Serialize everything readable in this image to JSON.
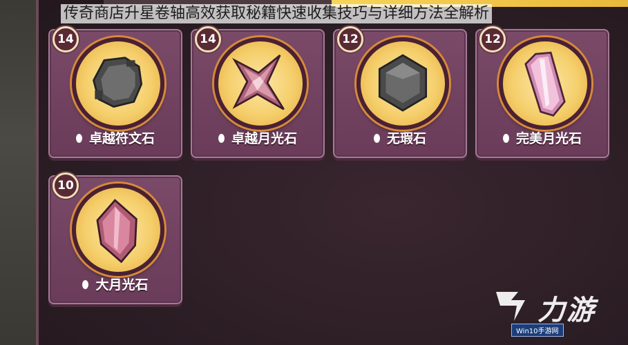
{
  "page": {
    "title": "传奇商店升星卷轴高效获取秘籍快速收集技巧与详细方法全解析"
  },
  "items": [
    {
      "name": "卓越符文石",
      "count": "14",
      "icon": "rune-stone-icon",
      "color": "#5a5a5a"
    },
    {
      "name": "卓越月光石",
      "count": "14",
      "icon": "moonstone-star-icon",
      "color": "#b0607a"
    },
    {
      "name": "无瑕石",
      "count": "12",
      "icon": "flawless-stone-icon",
      "color": "#5a5a5a"
    },
    {
      "name": "完美月光石",
      "count": "12",
      "icon": "perfect-moonstone-crystal-icon",
      "color": "#e8a3c8"
    },
    {
      "name": "大月光石",
      "count": "10",
      "icon": "large-moonstone-crystal-icon",
      "color": "#c06a80"
    }
  ],
  "watermark": {
    "brand": "力游",
    "sub": "Win10手游网"
  },
  "colors": {
    "card_bg": "#7a4a68",
    "medallion": "#f5cf6c",
    "badge_bg": "#5a2a34",
    "gold_bar": "#f7d45a"
  }
}
